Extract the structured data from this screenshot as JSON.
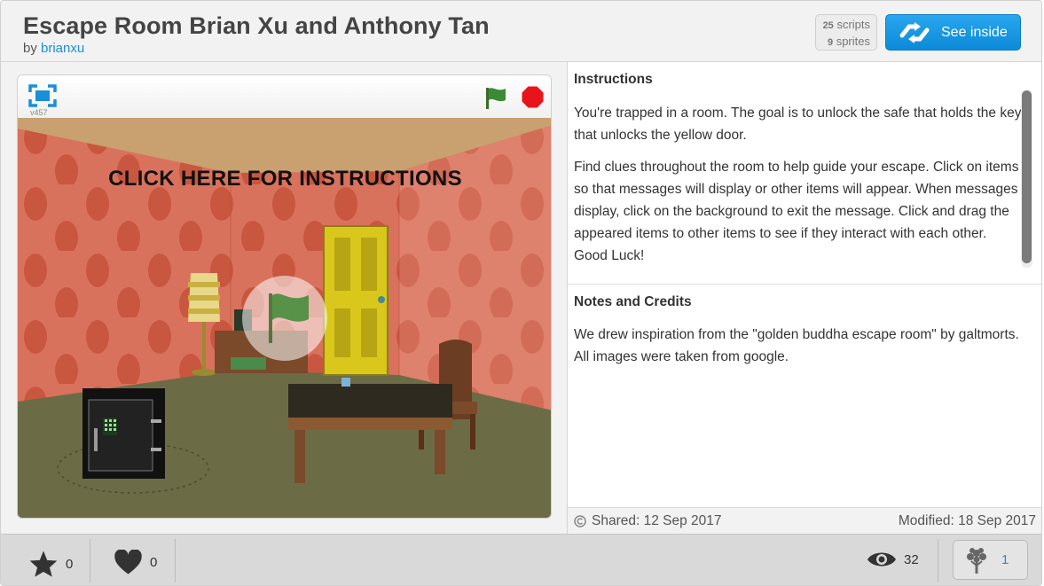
{
  "project": {
    "title": "Escape Room Brian Xu and Anthony Tan",
    "by_prefix": "by",
    "author": "brianxu"
  },
  "counts": {
    "scripts_count": "25",
    "scripts_label": "scripts",
    "sprites_count": "9",
    "sprites_label": "sprites"
  },
  "see_inside_label": "See inside",
  "player": {
    "version": "v457",
    "stage_caption": "CLICK HERE FOR INSTRUCTIONS"
  },
  "instructions": {
    "title": "Instructions",
    "paragraphs": [
      "You're trapped in a room. The goal is to unlock the safe that holds the key that unlocks the yellow door.",
      "Find clues throughout the room to help guide your escape. Click on items so that messages will display or other items will appear. When messages display, click on the background to exit the message. Click and drag the appeared items to other items to see if they interact with each other. Good Luck!"
    ]
  },
  "notes": {
    "title": "Notes and Credits",
    "body": "We drew inspiration from the \"golden buddha escape room\" by galtmorts. All images were taken from google."
  },
  "meta": {
    "shared": "Shared: 12 Sep 2017",
    "modified": "Modified: 18 Sep 2017"
  },
  "footer": {
    "favorites": "0",
    "loves": "0",
    "views": "32",
    "remixes": "1"
  },
  "colors": {
    "accent_blue": "#1a8fd6",
    "wall": "#d8725c",
    "floor": "#6a6b44",
    "door": "#d9c81b",
    "stop_red": "#e8141a",
    "flag_green": "#3d8a35"
  }
}
